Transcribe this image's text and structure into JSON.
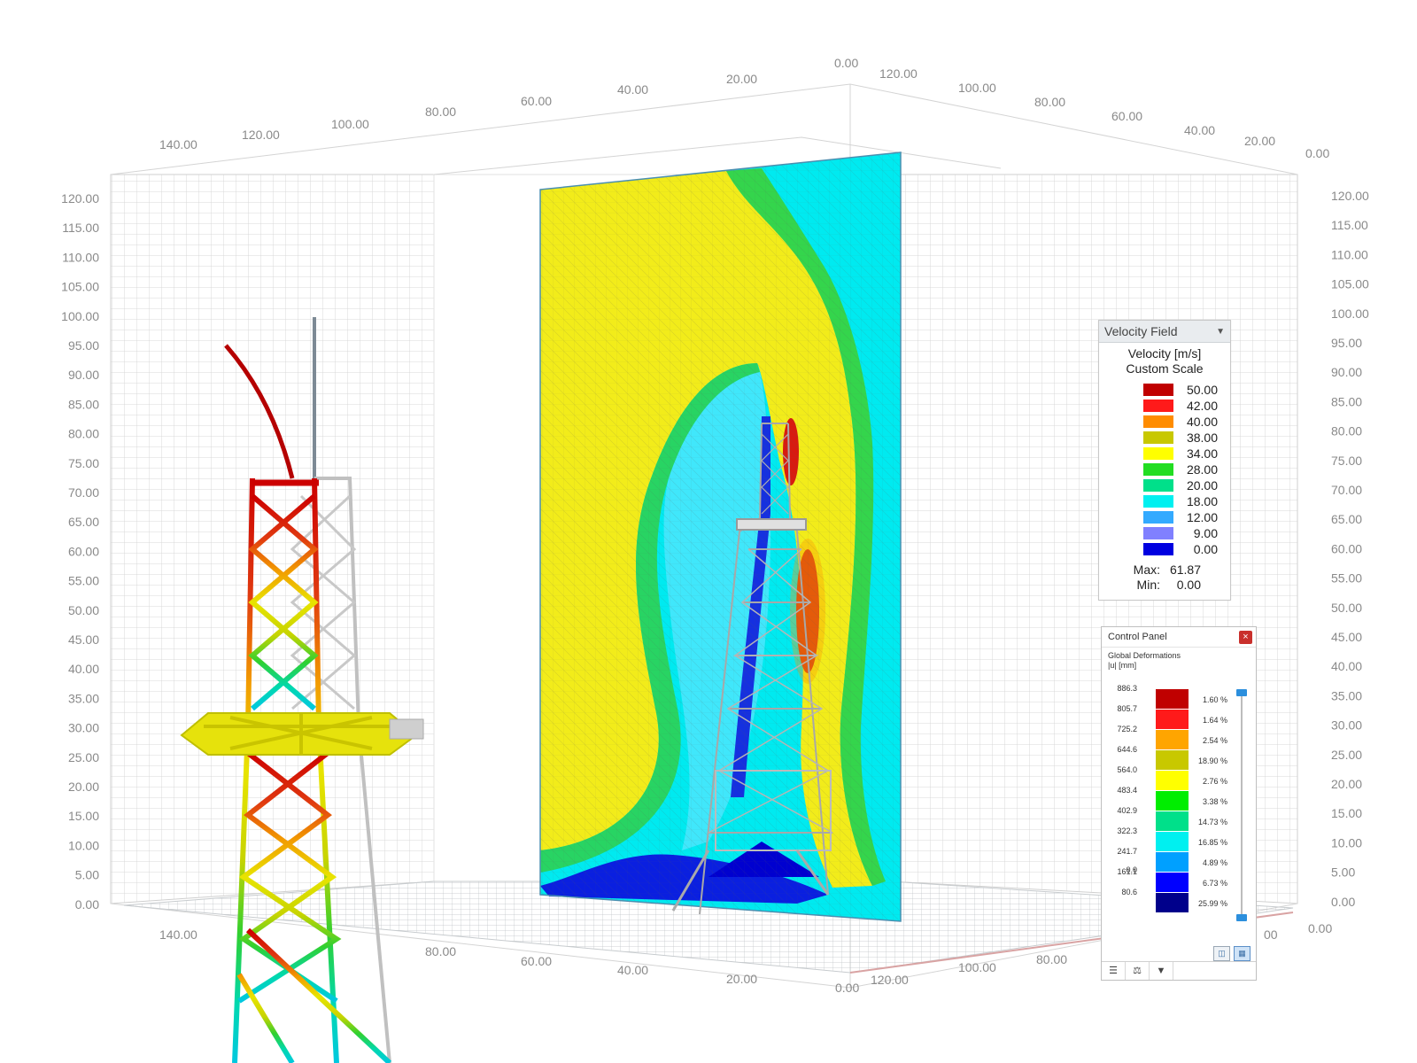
{
  "axes": {
    "vertical_ticks": [
      "120.00",
      "115.00",
      "110.00",
      "105.00",
      "100.00",
      "95.00",
      "90.00",
      "85.00",
      "80.00",
      "75.00",
      "70.00",
      "65.00",
      "60.00",
      "55.00",
      "50.00",
      "45.00",
      "40.00",
      "35.00",
      "30.00",
      "25.00",
      "20.00",
      "15.00",
      "10.00",
      "5.00",
      "0.00"
    ],
    "top_left_ticks": [
      "140.00",
      "120.00",
      "100.00",
      "80.00",
      "60.00",
      "40.00",
      "20.00",
      "0.00"
    ],
    "top_right_ticks": [
      "120.00",
      "100.00",
      "80.00",
      "60.00",
      "40.00",
      "20.00",
      "0.00"
    ],
    "bottom_left_ticks": [
      "140.00",
      "80.00",
      "60.00",
      "40.00",
      "20.00",
      "0.00"
    ],
    "bottom_right_ticks": [
      "120.00",
      "100.00",
      "80.00",
      "00",
      "0.00"
    ]
  },
  "velocity_legend": {
    "title": "Velocity Field",
    "quantity": "Velocity [m/s]",
    "scale": "Custom Scale",
    "entries": [
      {
        "value": "50.00",
        "color": "#c00000"
      },
      {
        "value": "42.00",
        "color": "#ff1a1a"
      },
      {
        "value": "40.00",
        "color": "#ff8c00"
      },
      {
        "value": "38.00",
        "color": "#c8c800"
      },
      {
        "value": "34.00",
        "color": "#ffff00"
      },
      {
        "value": "28.00",
        "color": "#22dd22"
      },
      {
        "value": "20.00",
        "color": "#00e08a"
      },
      {
        "value": "18.00",
        "color": "#00f0f0"
      },
      {
        "value": "12.00",
        "color": "#33aaff"
      },
      {
        "value": "9.00",
        "color": "#8080ff"
      },
      {
        "value": "0.00",
        "color": "#0000e0"
      }
    ],
    "max_label": "Max:",
    "max_value": "61.87",
    "min_label": "Min:",
    "min_value": "0.00"
  },
  "control_panel": {
    "title": "Control Panel",
    "close_icon": "close-icon",
    "result_name": "Global Deformations",
    "result_unit": "|u| [mm]",
    "rows": [
      {
        "value": "886.3",
        "color": "#c00000",
        "percent": "1.60 %"
      },
      {
        "value": "805.7",
        "color": "#ff1a1a",
        "percent": "1.64 %"
      },
      {
        "value": "725.2",
        "color": "#ffa500",
        "percent": "2.54 %"
      },
      {
        "value": "644.6",
        "color": "#c8c800",
        "percent": "18.90 %"
      },
      {
        "value": "564.0",
        "color": "#ffff00",
        "percent": "2.76 %"
      },
      {
        "value": "483.4",
        "color": "#00ee00",
        "percent": "3.38 %"
      },
      {
        "value": "402.9",
        "color": "#00e08a",
        "percent": "14.73 %"
      },
      {
        "value": "322.3",
        "color": "#00f0f0",
        "percent": "16.85 %"
      },
      {
        "value": "241.7",
        "color": "#00a0ff",
        "percent": "4.89 %"
      },
      {
        "value": "161.1",
        "color": "#0000ff",
        "percent": "6.73 %"
      },
      {
        "value": "80.6",
        "color": "#00008b",
        "percent": "25.99 %"
      }
    ],
    "last_value": "0.0",
    "tools": [
      "export-icon",
      "scale-icon"
    ],
    "tabs": [
      "color-scale-icon",
      "balance-icon",
      "filter-icon"
    ]
  }
}
